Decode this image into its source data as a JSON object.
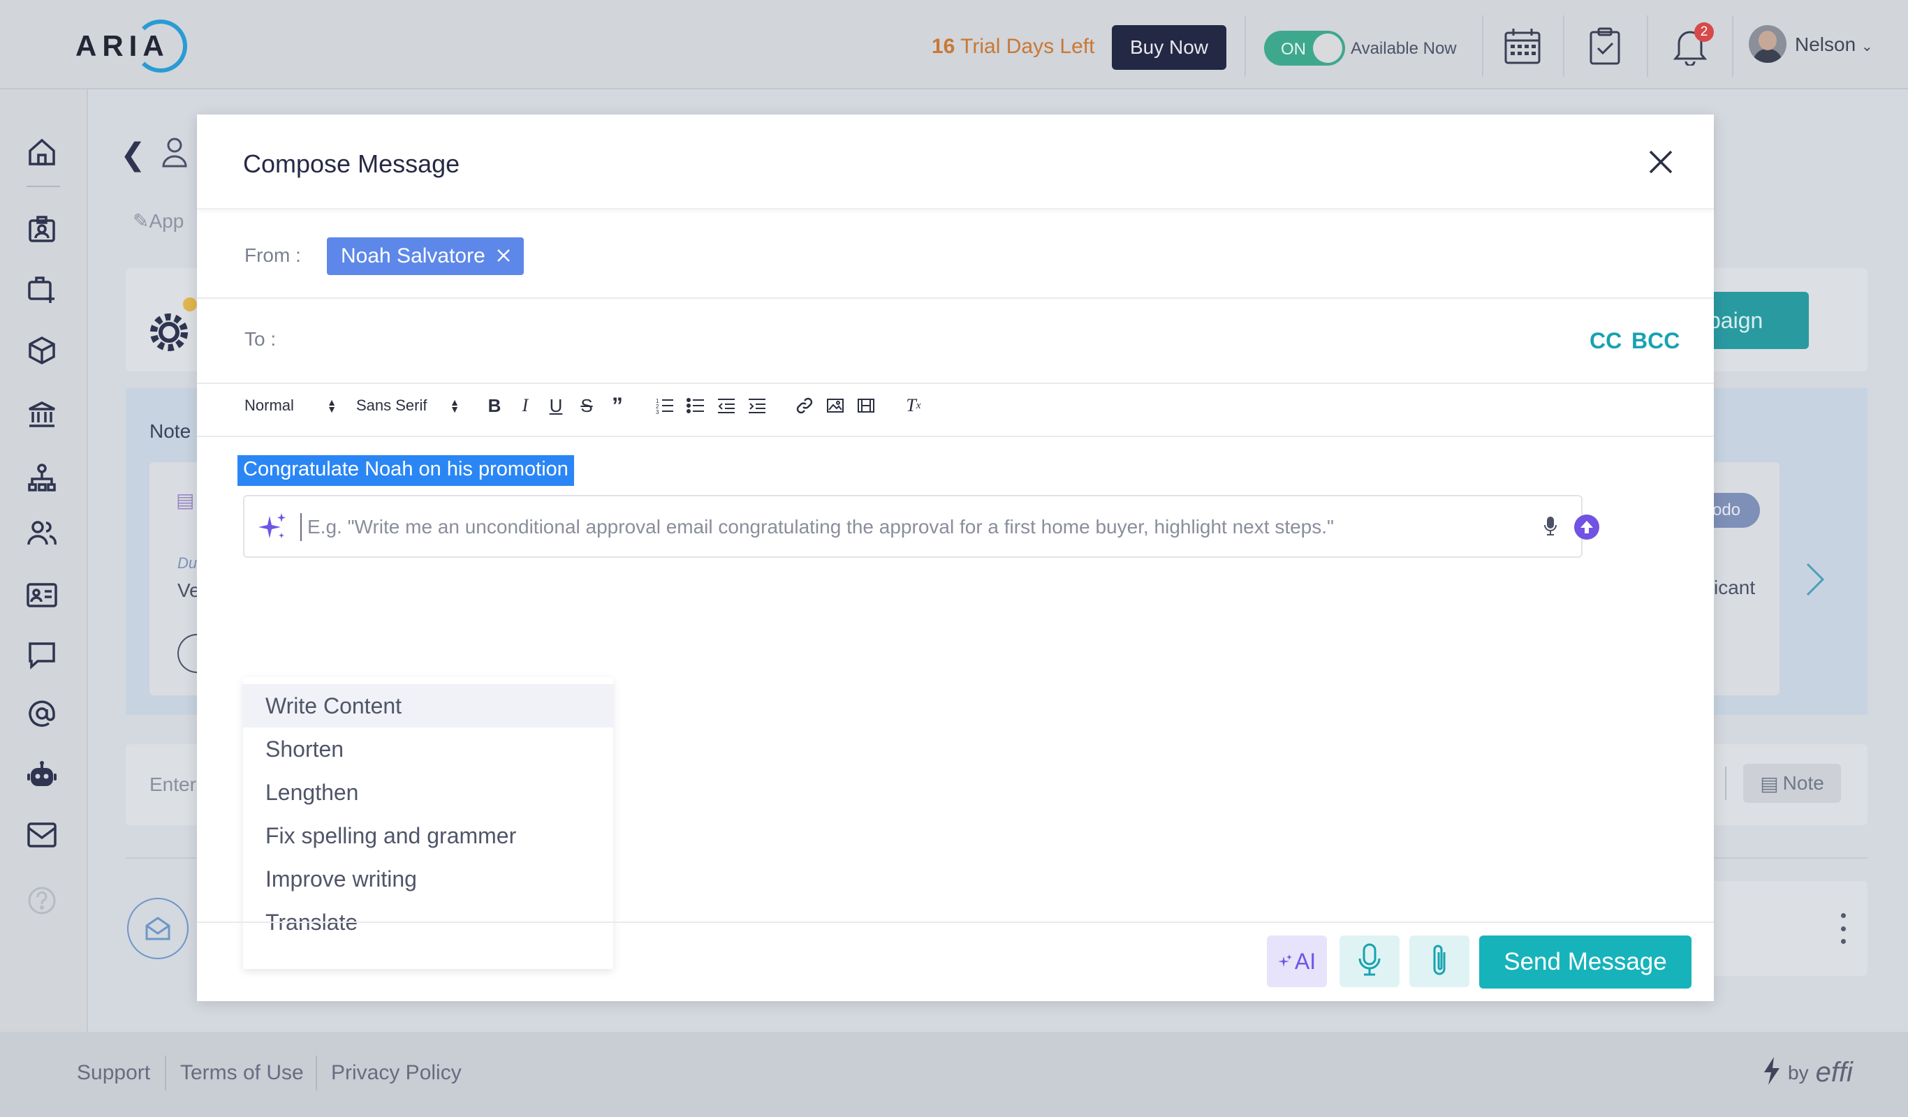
{
  "app": {
    "logo": "ARIA"
  },
  "header": {
    "trial_days": "16",
    "trial_text": "Trial Days Left",
    "buy_label": "Buy Now",
    "toggle_label": "ON",
    "availability": "Available Now",
    "notification_count": "2",
    "user_name": "Nelson"
  },
  "sidebar": {
    "items": [
      "home-icon",
      "contacts-icon",
      "add-briefcase-icon",
      "box-icon",
      "bank-icon",
      "org-chart-icon",
      "team-icon",
      "id-card-icon",
      "chat-icon",
      "at-sign-icon",
      "bot-icon",
      "mail-icon",
      "help-icon"
    ]
  },
  "background": {
    "tab_label": "App",
    "notes_label": "Note",
    "due_label": "Du",
    "ve_text": "Ve",
    "campaign_label": "paign",
    "todo_label": "odo",
    "applicant_text": "icant",
    "enter_text": "Enter",
    "note_chip": "Note"
  },
  "modal": {
    "title": "Compose Message",
    "from_label": "From :",
    "from_value": "Noah Salvatore",
    "to_label": "To :",
    "cc_label": "CC",
    "bcc_label": "BCC",
    "toolbar": {
      "heading_value": "Normal",
      "font_value": "Sans Serif"
    },
    "selected_text": "Congratulate Noah on his promotion",
    "ai_prompt": {
      "placeholder": "E.g. \"Write me an unconditional approval email congratulating the approval for a first home buyer, highlight next steps.\"",
      "value": ""
    },
    "ai_menu": [
      "Write Content",
      "Shorten",
      "Lengthen",
      "Fix spelling and grammer",
      "Improve writing",
      "Translate"
    ],
    "ai_button_label": "AI",
    "send_label": "Send Message"
  },
  "footer": {
    "links": [
      "Support",
      "Terms of Use",
      "Privacy Policy"
    ],
    "by": "by",
    "brand": "effi"
  },
  "colors": {
    "accent_teal": "#17b3ba",
    "chip_blue": "#5d88e9",
    "selection_blue": "#2b86f5",
    "ai_purple": "#7152e3"
  }
}
